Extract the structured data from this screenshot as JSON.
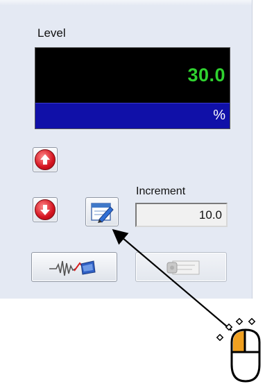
{
  "level": {
    "label": "Level",
    "value": "30.0",
    "unit": "%"
  },
  "controls": {
    "up_icon": "arrow-up-icon",
    "down_icon": "arrow-down-icon",
    "edit_icon": "edit-pencil-icon",
    "wave_icon": "waveform-icon",
    "disabled_icon": "disabled-slider-icon"
  },
  "increment": {
    "label": "Increment",
    "value": "10.0"
  },
  "annotation": {
    "cursor_icon": "mouse-left-click-icon",
    "arrow_target": "edit-button"
  },
  "colors": {
    "panel_bg": "#e4e9f3",
    "display_bg": "#000000",
    "value_green": "#2fd12f",
    "unit_bar_blue": "#1010a8",
    "arrow_button_red": "#d4131f",
    "mouse_highlight": "#f0a020"
  }
}
